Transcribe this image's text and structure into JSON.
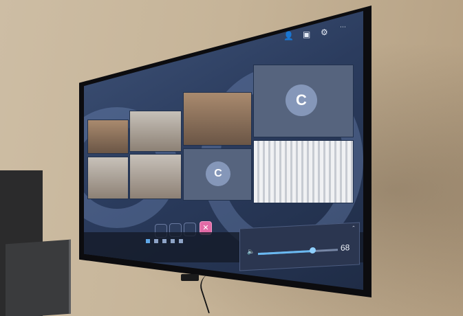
{
  "photo": {
    "type": "wall-mounted TV displaying a video meeting",
    "colors": {
      "wall": "#c6b498",
      "tv_bezel": "#0c0c0f",
      "screen_bg": "#2b3c5e",
      "accent": "#69b8f0",
      "leave_button": "#e26aa6"
    }
  },
  "meeting": {
    "title": "",
    "tiles": [
      {
        "kind": "video"
      },
      {
        "kind": "video"
      },
      {
        "kind": "video"
      },
      {
        "kind": "avatar",
        "initial": "C"
      },
      {
        "kind": "video"
      },
      {
        "kind": "video"
      },
      {
        "kind": "avatar",
        "initial": "C"
      },
      {
        "kind": "video-blinds"
      }
    ],
    "controls": [
      {
        "icon": "mic-icon"
      },
      {
        "icon": "camera-icon"
      },
      {
        "icon": "share-icon"
      },
      {
        "icon": "leave-icon",
        "glyph": "✕"
      }
    ]
  },
  "volume_flyout": {
    "device": "",
    "level": 68,
    "level_text": "68"
  },
  "taskbar": {
    "weather": "",
    "time": "",
    "date": ""
  }
}
